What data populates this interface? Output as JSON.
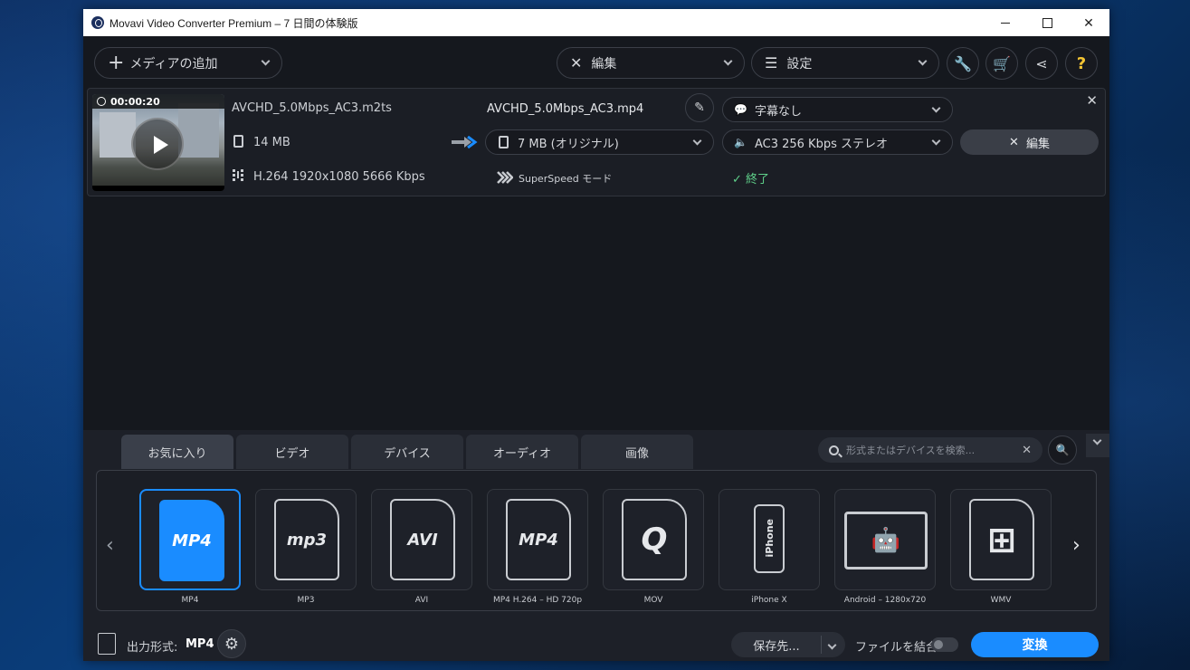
{
  "window": {
    "title": "Movavi Video Converter Premium – 7 日間の体験版",
    "close_symbol": "✕"
  },
  "toolbar": {
    "add_media": "メディアの追加",
    "edit": "編集",
    "settings": "設定",
    "icons": [
      "wrench-icon",
      "cart-icon",
      "share-icon",
      "help-icon"
    ],
    "help_symbol": "?"
  },
  "file": {
    "duration": "00:00:20",
    "source_name": "AVCHD_5.0Mbps_AC3.m2ts",
    "source_size": "14 MB",
    "source_video": "H.264  1920x1080  5666 Kbps",
    "output_name": "AVCHD_5.0Mbps_AC3.mp4",
    "output_size": "7 MB (オリジナル)",
    "superspeed": "SuperSpeed モード",
    "subtitles": "字幕なし",
    "audio": "AC3 256 Kbps ステレオ",
    "edit_button": "編集",
    "status": "終了"
  },
  "tabs": [
    {
      "label": "お気に入り",
      "active": true
    },
    {
      "label": "ビデオ",
      "active": false
    },
    {
      "label": "デバイス",
      "active": false
    },
    {
      "label": "オーディオ",
      "active": false
    },
    {
      "label": "画像",
      "active": false
    }
  ],
  "search": {
    "placeholder": "形式またはデバイスを検索..."
  },
  "presets": [
    {
      "label": "MP4",
      "icon_text": "MP4"
    },
    {
      "label": "MP3",
      "icon_text": "mp3"
    },
    {
      "label": "AVI",
      "icon_text": "AVI"
    },
    {
      "label": "MP4 H.264 – HD 720p",
      "icon_text": "MP4"
    },
    {
      "label": "MOV",
      "icon_text": "Q"
    },
    {
      "label": "iPhone X",
      "icon_text": "iPhone"
    },
    {
      "label": "Android – 1280x720",
      "icon_text": "🤖"
    },
    {
      "label": "WMV",
      "icon_text": "⊞"
    }
  ],
  "footer": {
    "output_format_label": "出力形式:",
    "output_format_value": "MP4",
    "save_to": "保存先...",
    "merge_files": "ファイルを結合:",
    "convert": "変換"
  },
  "colors": {
    "accent": "#1a8cff",
    "done": "#5fd08a"
  }
}
